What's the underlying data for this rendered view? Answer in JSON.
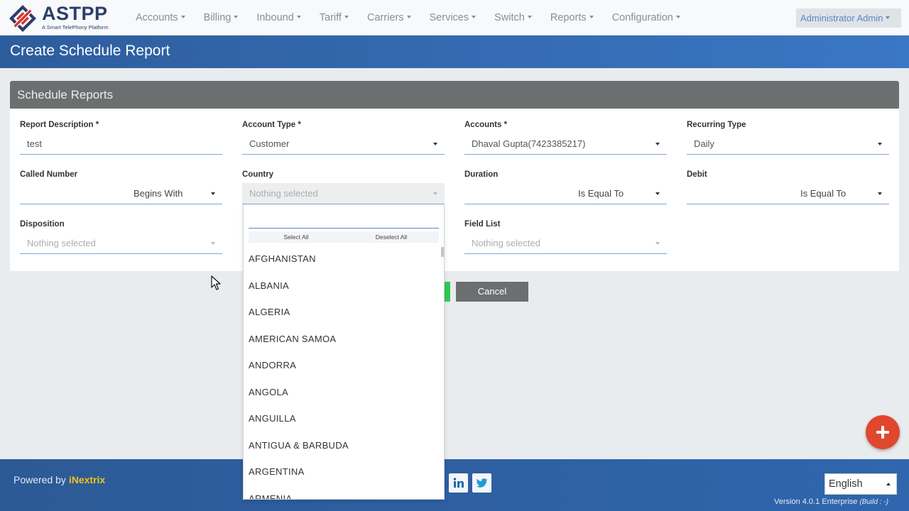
{
  "app": {
    "logo_text": "ASTPP",
    "logo_sub": "A Smart TelePhony Platform"
  },
  "nav": {
    "items": [
      {
        "label": "Accounts"
      },
      {
        "label": "Billing"
      },
      {
        "label": "Inbound"
      },
      {
        "label": "Tariff"
      },
      {
        "label": "Carriers"
      },
      {
        "label": "Services"
      },
      {
        "label": "Switch"
      },
      {
        "label": "Reports"
      },
      {
        "label": "Configuration"
      }
    ],
    "user": "Administrator Admin"
  },
  "page": {
    "title": "Create Schedule Report"
  },
  "panel": {
    "title": "Schedule Reports"
  },
  "form": {
    "report_description": {
      "label": "Report Description *",
      "value": "test"
    },
    "account_type": {
      "label": "Account Type *",
      "value": "Customer"
    },
    "accounts": {
      "label": "Accounts *",
      "value": "Dhaval Gupta(7423385217)"
    },
    "recurring_type": {
      "label": "Recurring Type",
      "value": "Daily"
    },
    "called_number": {
      "label": "Called Number",
      "value": "",
      "operator": "Begins With"
    },
    "country": {
      "label": "Country",
      "placeholder": "Nothing selected"
    },
    "duration": {
      "label": "Duration",
      "value": "",
      "operator": "Is Equal To"
    },
    "debit": {
      "label": "Debit",
      "value": "",
      "operator": "Is Equal To"
    },
    "disposition": {
      "label": "Disposition",
      "placeholder": "Nothing selected"
    },
    "field_list": {
      "label": "Field List",
      "placeholder": "Nothing selected"
    }
  },
  "buttons": {
    "cancel": "Cancel"
  },
  "country_dropdown": {
    "select_all": "Select All",
    "deselect_all": "Deselect All",
    "options": [
      "AFGHANISTAN",
      "ALBANIA",
      "ALGERIA",
      "AMERICAN SAMOA",
      "ANDORRA",
      "ANGOLA",
      "ANGUILLA",
      "ANTIGUA & BARBUDA",
      "ARGENTINA",
      "ARMENIA"
    ]
  },
  "footer": {
    "powered_prefix": "Powered by ",
    "powered_brand": "iNextrix",
    "language": "English",
    "version": "Version 4.0.1 Enterprise",
    "build": "(Build : -)"
  },
  "colors": {
    "brand_blue": "#2e5d9d",
    "panel_header": "#6c6f6f",
    "accent_orange": "#e0472c",
    "brand_yellow": "#f2c318"
  }
}
